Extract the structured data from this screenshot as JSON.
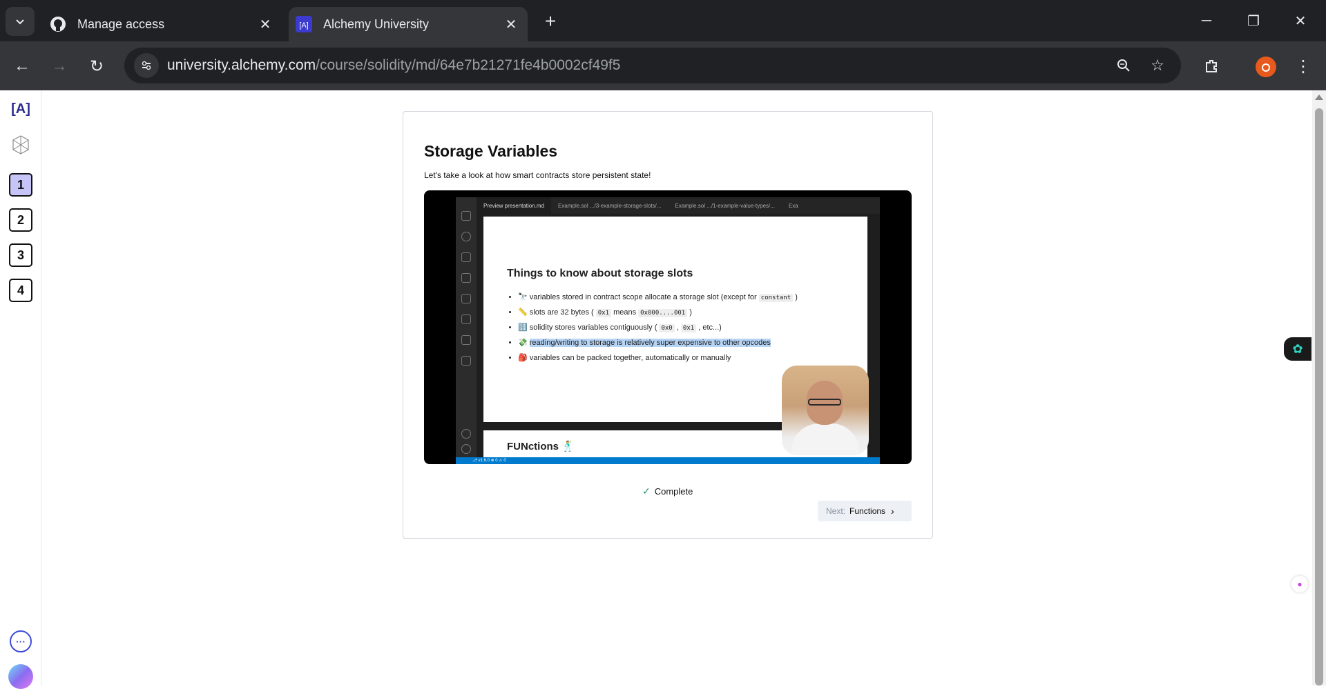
{
  "browser": {
    "tabs": [
      {
        "title": "Manage access",
        "icon": "github-icon"
      },
      {
        "title": "Alchemy University",
        "icon": "alchemy-icon",
        "active": true
      }
    ],
    "new_tab_symbol": "+",
    "url_host": "university.alchemy.com",
    "url_path": "/course/solidity/md/64e7b21271fe4b0002cf49f5"
  },
  "sidebar": {
    "logo_text": "[A]",
    "steps": [
      {
        "label": "1",
        "current": true
      },
      {
        "label": "2"
      },
      {
        "label": "3"
      },
      {
        "label": "4"
      }
    ],
    "more_label": "···"
  },
  "lesson": {
    "title": "Storage Variables",
    "subtitle": "Let's take a look at how smart contracts store persistent state!",
    "complete_label": "Complete",
    "next_prefix": "Next:",
    "next_name": "Functions"
  },
  "video": {
    "ide_tabs": [
      "Preview presentation.md",
      "Example.sol .../3-example-storage-slots/...",
      "Example.sol .../1-example-value-types/...",
      "Exa"
    ],
    "slide_title": "Things to know about storage slots",
    "bullets": [
      {
        "emoji": "🔭",
        "text": "variables stored in contract scope allocate a storage slot (except for ",
        "code": "constant",
        "after": " )"
      },
      {
        "emoji": "📏",
        "text": "slots are 32 bytes ( ",
        "code": "0x1",
        "after": " means ",
        "code2": "0x000....001",
        "after2": " )"
      },
      {
        "emoji": "🔢",
        "text": "solidity stores variables contiguously ( ",
        "code": "0x0",
        "after": " , ",
        "code2": "0x1",
        "after2": " , etc...)"
      },
      {
        "emoji": "💸",
        "text": "",
        "highlight": "reading/writing to storage is relatively super expensive to other opcodes"
      },
      {
        "emoji": "🎒",
        "text": "variables can be packed together, automatically or manually"
      }
    ],
    "next_slide_title": "FUNctions 🕺",
    "status_text": "⎇ v1.6.0  ⊗ 0 ⚠ 0"
  },
  "colors": {
    "chrome_dark": "#202124",
    "chrome_mid": "#35363a",
    "step_current": "#c7c5f7",
    "accent": "#3b4bd8"
  }
}
